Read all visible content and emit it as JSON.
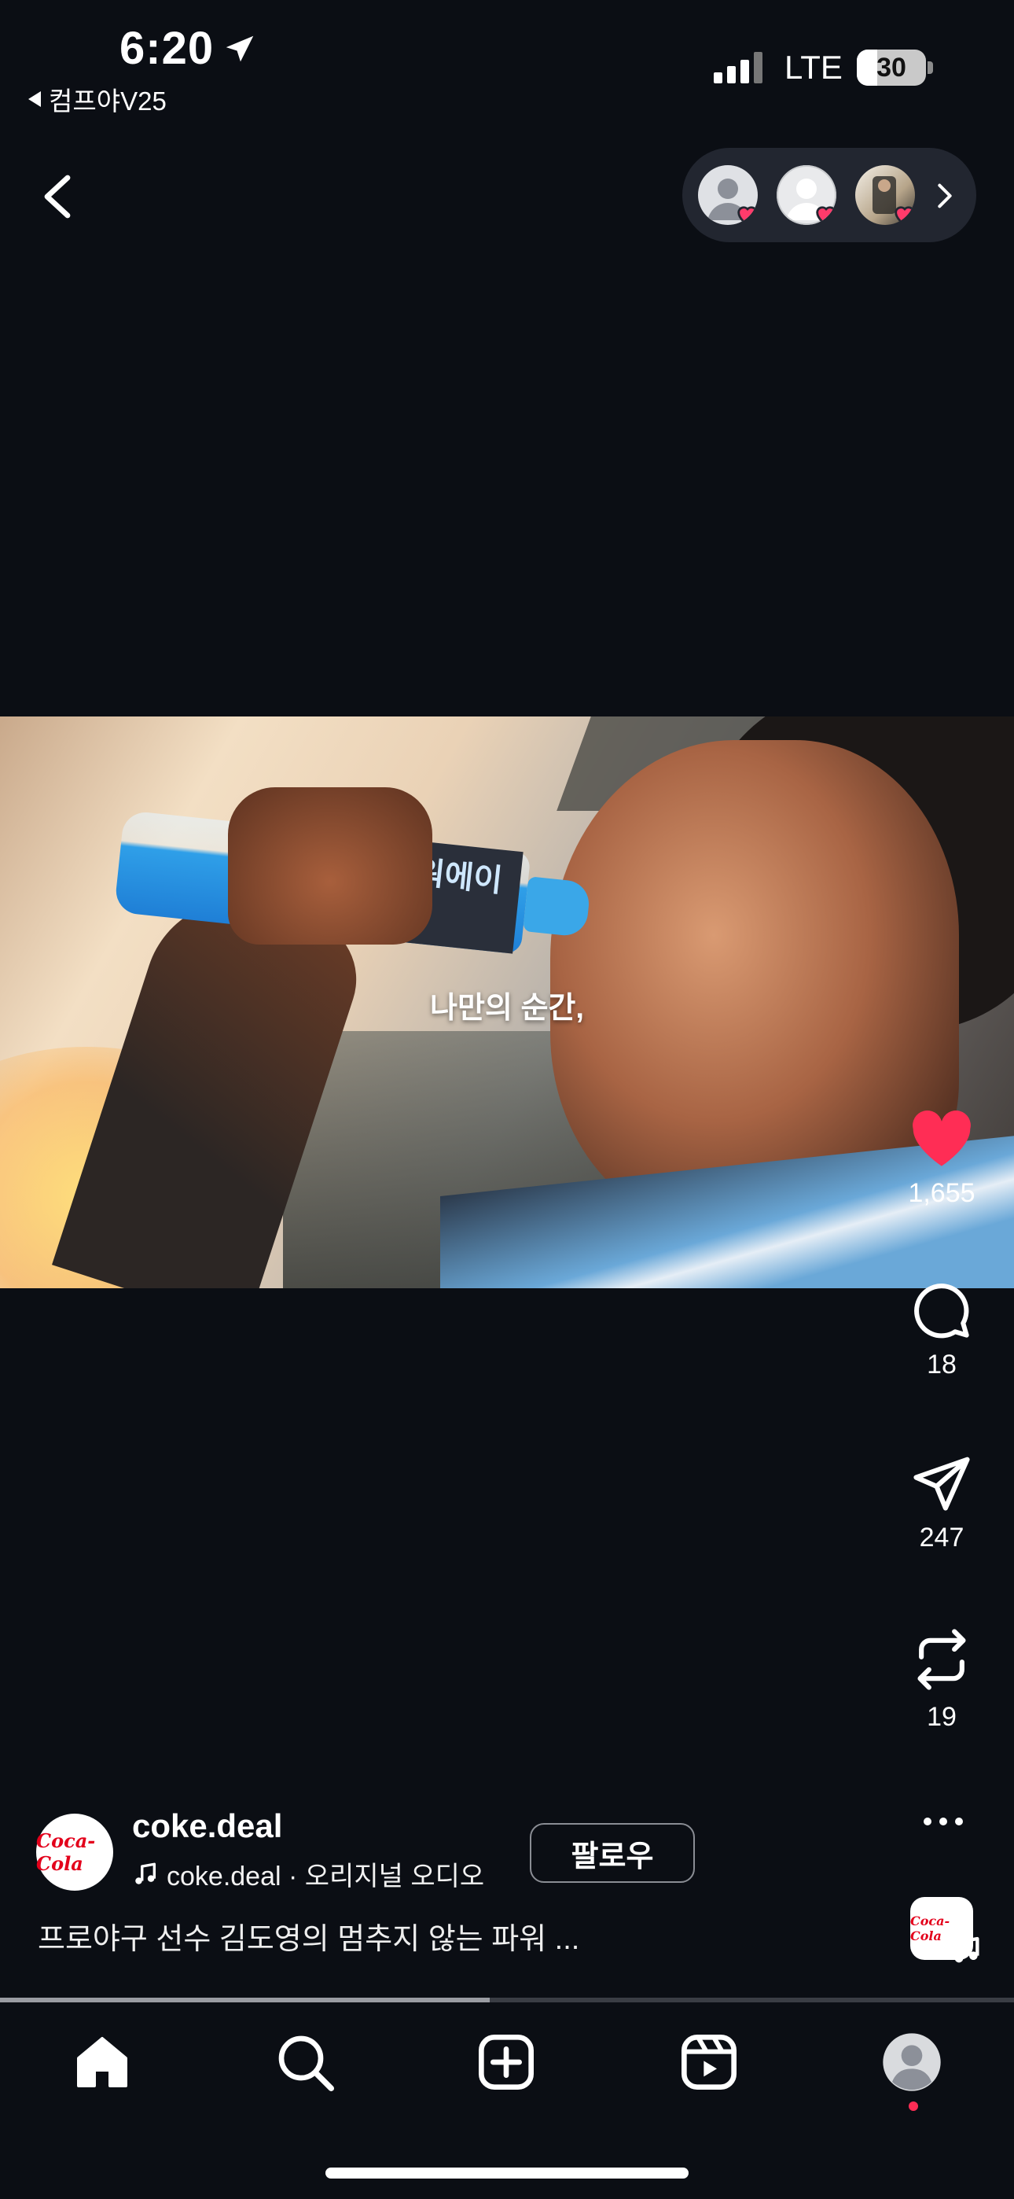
{
  "status_bar": {
    "time": "6:20",
    "back_app": "컴프야V25",
    "network": "LTE",
    "battery_level": "30",
    "battery_fraction": 0.3
  },
  "header": {
    "back_icon": "chevron-left-icon",
    "likers_chevron_icon": "chevron-right-icon"
  },
  "video": {
    "caption": "나만의 순간,",
    "bottle_label": "파워에이드"
  },
  "actions": {
    "likes": "1,655",
    "comments": "18",
    "shares": "247",
    "reposts": "19",
    "like_color": "#ff2d55"
  },
  "post": {
    "avatar_text": "Coca-Cola",
    "username": "coke.deal",
    "audio": "coke.deal · 오리지널 오디오",
    "follow_label": "팔로우",
    "caption": "프로야구 선수 김도영의 멈추지 않는 파워 ...",
    "audio_thumb_text": "Coca-Cola"
  },
  "playback": {
    "progress_fraction": 0.483
  },
  "tab_bar": {
    "items": [
      "home-icon",
      "search-icon",
      "create-icon",
      "reels-icon",
      "profile-icon"
    ]
  }
}
